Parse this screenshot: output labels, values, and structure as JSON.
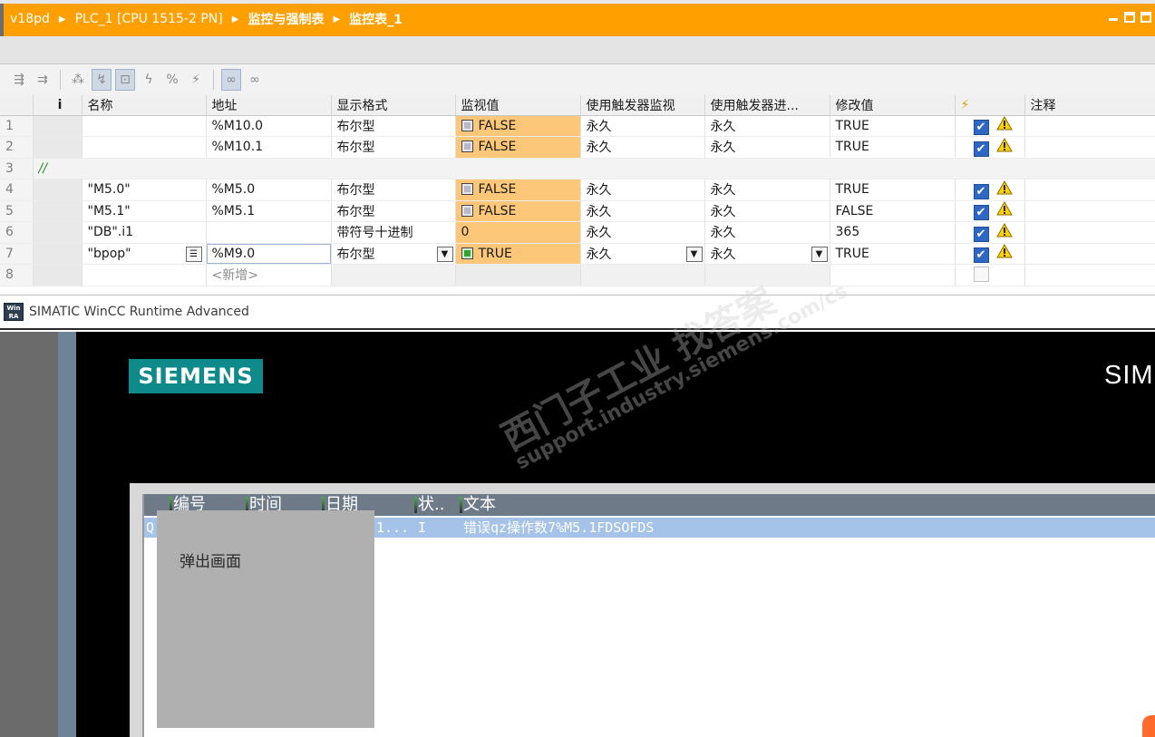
{
  "breadcrumb": {
    "items": [
      "v18pd",
      "PLC_1 [CPU 1515-2 PN]",
      "监控与强制表",
      "监控表_1"
    ]
  },
  "toolbar": {
    "icons": [
      "insert-row-icon",
      "add-row-icon",
      "wildcard-icon",
      "show-all-modify-icon",
      "show-trigger-icon",
      "modify-now-icon",
      "modify-trigger-icon",
      "force-icon",
      "monitor-all-icon",
      "monitor-now-icon"
    ]
  },
  "table": {
    "headers": [
      "i",
      "名称",
      "地址",
      "显示格式",
      "监视值",
      "使用触发器监视",
      "使用触发器进...",
      "修改值",
      "",
      "注释"
    ],
    "rows": [
      {
        "num": "1",
        "name": "",
        "address": "%M10.0",
        "format": "布尔型",
        "monitor": "FALSE",
        "trig_mon": "永久",
        "trig_mod": "永久",
        "modify": "TRUE"
      },
      {
        "num": "2",
        "name": "",
        "address": "%M10.1",
        "format": "布尔型",
        "monitor": "FALSE",
        "trig_mon": "永久",
        "trig_mod": "永久",
        "modify": "TRUE"
      },
      {
        "num": "3",
        "comment": "//"
      },
      {
        "num": "4",
        "name": "\"M5.0\"",
        "address": "%M5.0",
        "format": "布尔型",
        "monitor": "FALSE",
        "trig_mon": "永久",
        "trig_mod": "永久",
        "modify": "TRUE"
      },
      {
        "num": "5",
        "name": "\"M5.1\"",
        "address": "%M5.1",
        "format": "布尔型",
        "monitor": "FALSE",
        "trig_mon": "永久",
        "trig_mod": "永久",
        "modify": "FALSE"
      },
      {
        "num": "6",
        "name": "\"DB\".i1",
        "address": "",
        "format": "带符号十进制",
        "monitor": "0",
        "trig_mon": "永久",
        "trig_mod": "永久",
        "modify": "365"
      },
      {
        "num": "7",
        "name": "\"bpop\"",
        "address": "%M9.0",
        "format": "布尔型",
        "monitor": "TRUE",
        "trig_mon": "永久",
        "trig_mod": "永久",
        "modify": "TRUE"
      },
      {
        "num": "8",
        "address_placeholder": "<新增>"
      }
    ]
  },
  "wincc": {
    "window_title": "SIMATIC WinCC Runtime Advanced",
    "logo_text": "SIEMENS",
    "right_text": "SIM",
    "alarm_headers": [
      "编号",
      "时间",
      "日期",
      "状..",
      "文本"
    ],
    "alarm_row": {
      "prefix": "Q",
      "date": "1...",
      "status": "I",
      "text": "错误qz操作数7%M5.1FDSOFDS"
    },
    "popup_text": "弹出画面"
  },
  "watermark": {
    "line1": "西门子工业 找答案",
    "line2": "support.industry.siemens.com/cs"
  },
  "colors": {
    "title_orange": "#ff9f00",
    "monitor_cell": "#fcc778",
    "siemens_teal": "#0e8a8a",
    "alarm_selected": "#a5c2e8"
  }
}
